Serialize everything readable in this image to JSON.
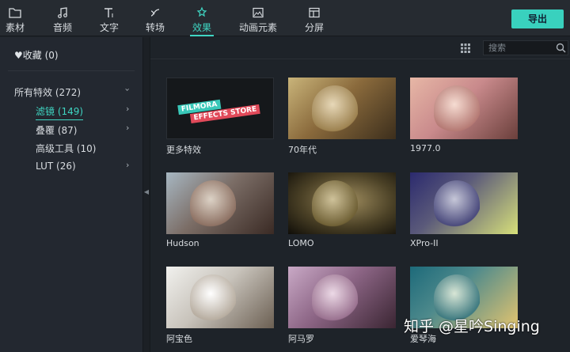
{
  "toolbar": {
    "tabs": [
      {
        "label": "素材",
        "icon": "folder-icon"
      },
      {
        "label": "音频",
        "icon": "music-note-icon"
      },
      {
        "label": "文字",
        "icon": "text-icon"
      },
      {
        "label": "转场",
        "icon": "transition-icon"
      },
      {
        "label": "效果",
        "icon": "effects-icon",
        "active": true
      },
      {
        "label": "动画元素",
        "icon": "image-icon"
      },
      {
        "label": "分屏",
        "icon": "split-screen-icon"
      }
    ],
    "export_label": "导出",
    "accent": "#3fd5c2"
  },
  "sidebar": {
    "favorites": "♥收藏 (0)",
    "categories": [
      {
        "label": "所有特效 (272)",
        "expanded": true
      },
      {
        "label": "滤镜 (149)",
        "selected": true
      },
      {
        "label": "叠覆 (87)"
      },
      {
        "label": "高级工具 (10)"
      },
      {
        "label": "LUT (26)"
      }
    ]
  },
  "main": {
    "search_placeholder": "搜索",
    "effects": [
      {
        "label": "更多特效",
        "store_line1": "FILMORA",
        "store_line2": "EFFECTS STORE"
      },
      {
        "label": "70年代"
      },
      {
        "label": "1977.0"
      },
      {
        "label": "Hudson"
      },
      {
        "label": "LOMO"
      },
      {
        "label": "XPro-II"
      },
      {
        "label": "阿宝色"
      },
      {
        "label": "阿马罗"
      },
      {
        "label": "爱琴海"
      }
    ]
  },
  "watermark": "知乎 @星吟Singing"
}
